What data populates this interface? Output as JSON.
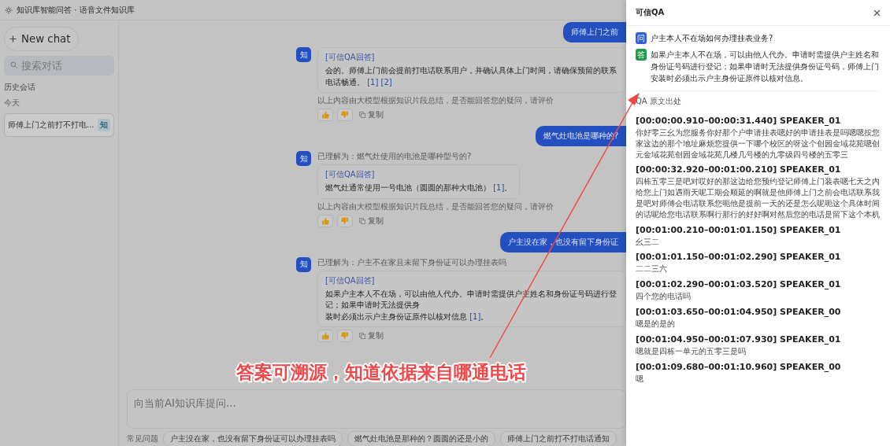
{
  "header": {
    "title": "知识库智能问答 · 语音文件知识库"
  },
  "sidebar": {
    "new_chat": "New chat",
    "search": {
      "placeholder": "搜索对话"
    },
    "history_title": "历史会话",
    "group": "今天",
    "items": [
      {
        "label": "师傅上门之前打不打电...",
        "badge": "知",
        "selected": true
      }
    ]
  },
  "chat": {
    "messages": [
      {
        "kind": "user",
        "text": "师傅上门之前"
      },
      {
        "kind": "bot",
        "avatar": "知",
        "label": "[可信QA回答]",
        "lines": [
          "会的。师傅上门前会提前打电话联系用户，并确认具体上门时间，请确保预留的联系电话畅通。"
        ],
        "citations": [
          "[1]",
          "[2]"
        ],
        "disclaimer": "以上内容由大模型根据知识片段总结，是否能回答您的疑问，请评价",
        "copy": "复制"
      },
      {
        "kind": "user",
        "text": "燃气灶电池是哪种的?"
      },
      {
        "kind": "bot",
        "avatar": "知",
        "understood": "已理解为：燃气灶使用的电池是哪种型号的?",
        "label": "[可信QA回答]",
        "lines": [
          "燃气灶通常使用一号电池（圆圆的那种大电池）"
        ],
        "citations": [
          "[1]"
        ],
        "tail": "。",
        "disclaimer": "以上内容由大模型根据知识片段总结，是否能回答您的疑问，请评价",
        "copy": "复制"
      },
      {
        "kind": "user",
        "text": "户主没在家，也没有留下身份证"
      },
      {
        "kind": "bot",
        "avatar": "知",
        "understood": "已理解为：户主不在家且未留下身份证可以办理挂表吗",
        "label": "[可信QA回答]",
        "lines": [
          "如果户主本人不在场，可以由他人代办。申请时需提供户主姓名和身份证号码进行登记；如果申请时无法提供身",
          "装时必须出示户主身份证原件以核对信息"
        ],
        "citations": [
          "[1]"
        ],
        "tail": "。",
        "copy": "复制"
      }
    ],
    "composer": {
      "placeholder": "向当前AI知识库提问..."
    },
    "suggestions_label": "常见问题",
    "suggestions": [
      "户主没在家，也没有留下身份证可以办理挂表吗",
      "燃气灶电池是那种的？圆圆的还是小的",
      "师傅上门之前打不打电话通知"
    ]
  },
  "drawer": {
    "title": "可信QA",
    "question_badge": "问",
    "question": "户主本人不在场如何办理挂表业务?",
    "answer_badge": "答",
    "answer": "如果户主本人不在场，可以由他人代办。申请时需提供户主姓名和身份证号码进行登记；如果申请时无法提供身份证号码，师傅上门安装时必须出示户主身份证原件以核对信息。",
    "source_title": "QA 原文出处",
    "transcript": [
      {
        "heading": "[00:00:00.910–00:00:31.440] SPEAKER_01",
        "text": "你好零三幺为您服务你好那个户申请挂表嗯好的申请挂表是吗嗯嗯按您家这边的那个地址麻烦您提供一下哪个校区的呀这个创园金域花苑嗯创元金域花苑创园金域花苑几楼几号楼的九零级四号楼的五零三"
      },
      {
        "heading": "[00:00:32.920–00:01:00.210] SPEAKER_01",
        "text": "四栋五零三是吧对哎好的那这边给您预约登记师傅上门装表嗯七天之内给您上门如遇雨天呢工期会顺延的啊就是他师傅上门之前会电话联系我是吧对师傅会电话联系您呃他是提前一天的还是怎么呢呃这个具体时间的话呢给您电话联系啊行那行的好好啊对然后您的电话是留下这个本机"
      },
      {
        "heading": "[00:01:00.210–00:01:01.150] SPEAKER_01",
        "text": "幺三二"
      },
      {
        "heading": "[00:01:01.150–00:01:02.290] SPEAKER_01",
        "text": "二二三六"
      },
      {
        "heading": "[00:01:02.290–00:01:03.520] SPEAKER_01",
        "text": "四个您的电话吗"
      },
      {
        "heading": "[00:01:03.650–00:01:04.950] SPEAKER_00",
        "text": "嗯是的是的"
      },
      {
        "heading": "[00:01:04.950–00:01:07.930] SPEAKER_01",
        "text": "嗯就是四栋一单元的五零三是吗"
      },
      {
        "heading": "[00:01:09.680–00:01:10.960] SPEAKER_00",
        "text": "嗯"
      }
    ]
  },
  "annotation": {
    "text": "答案可溯源，知道依据来自哪通电话"
  }
}
